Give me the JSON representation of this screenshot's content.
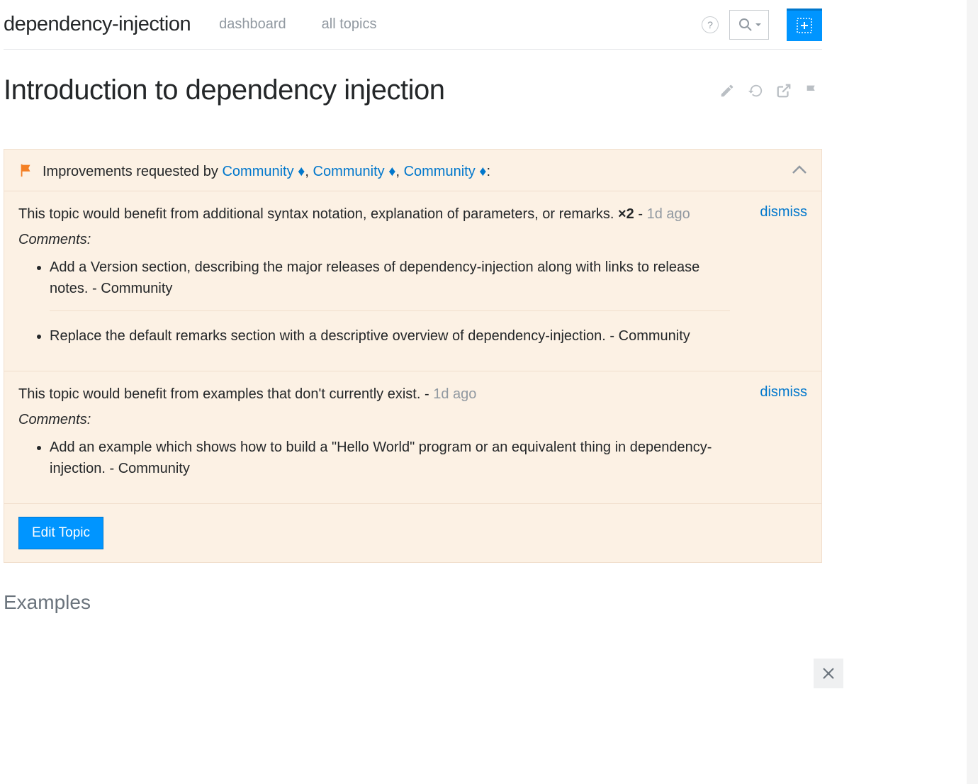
{
  "topbar": {
    "title": "dependency-injection",
    "links": {
      "dashboard": "dashboard",
      "all_topics": "all topics"
    },
    "help": "?"
  },
  "page": {
    "title": "Introduction to dependency injection"
  },
  "improvements": {
    "header_prefix": "Improvements requested by ",
    "diamond": "♦",
    "sep": ", ",
    "colon": ":",
    "requesters": [
      "Community",
      "Community",
      "Community"
    ],
    "items": [
      {
        "text": "This topic would benefit from additional syntax notation, explanation of parameters, or remarks. ",
        "count": "×2",
        "dash": " - ",
        "time": "1d ago",
        "comments_label": "Comments:",
        "dismiss": "dismiss",
        "comments": [
          "Add a Version section, describing the major releases of dependency-injection along with links to release notes. - Community",
          "Replace the default remarks section with a descriptive overview of dependency-injection. - Community"
        ]
      },
      {
        "text": "This topic would benefit from examples that don't currently exist.",
        "dash": " - ",
        "time": "1d ago",
        "comments_label": "Comments:",
        "dismiss": "dismiss",
        "comments": [
          "Add an example which shows how to build a \"Hello World\" program or an equivalent thing in dependency-injection. - Community"
        ]
      }
    ],
    "edit_button": "Edit Topic"
  },
  "examples_heading": "Examples",
  "close_x": "×"
}
